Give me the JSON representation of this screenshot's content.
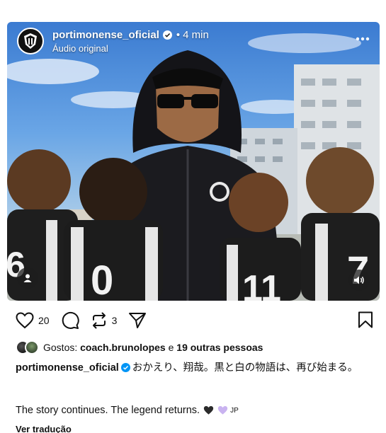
{
  "post": {
    "username": "portimonense_oficial",
    "time_separator": "•",
    "time": "4 min",
    "audio": "Áudio original",
    "more_icon": "more-horizontal-icon"
  },
  "actions": {
    "like_count": "20",
    "repost_count": "3"
  },
  "likes": {
    "prefix": "Gostos:",
    "first_liker": "coach.brunolopes",
    "joiner": "e",
    "others": "19 outras pessoas"
  },
  "caption": {
    "username": "portimonense_oficial",
    "text_jp": "おかえり、翔哉。黒と白の物語は、再び始まる。",
    "text_en": "The story continues. The legend returns.",
    "jp_tag": "JP",
    "translate": "Ver tradução"
  },
  "colors": {
    "verified": "#0095f6",
    "heart_black": "#2b2b2b",
    "heart_purple": "#c9b3f0"
  }
}
